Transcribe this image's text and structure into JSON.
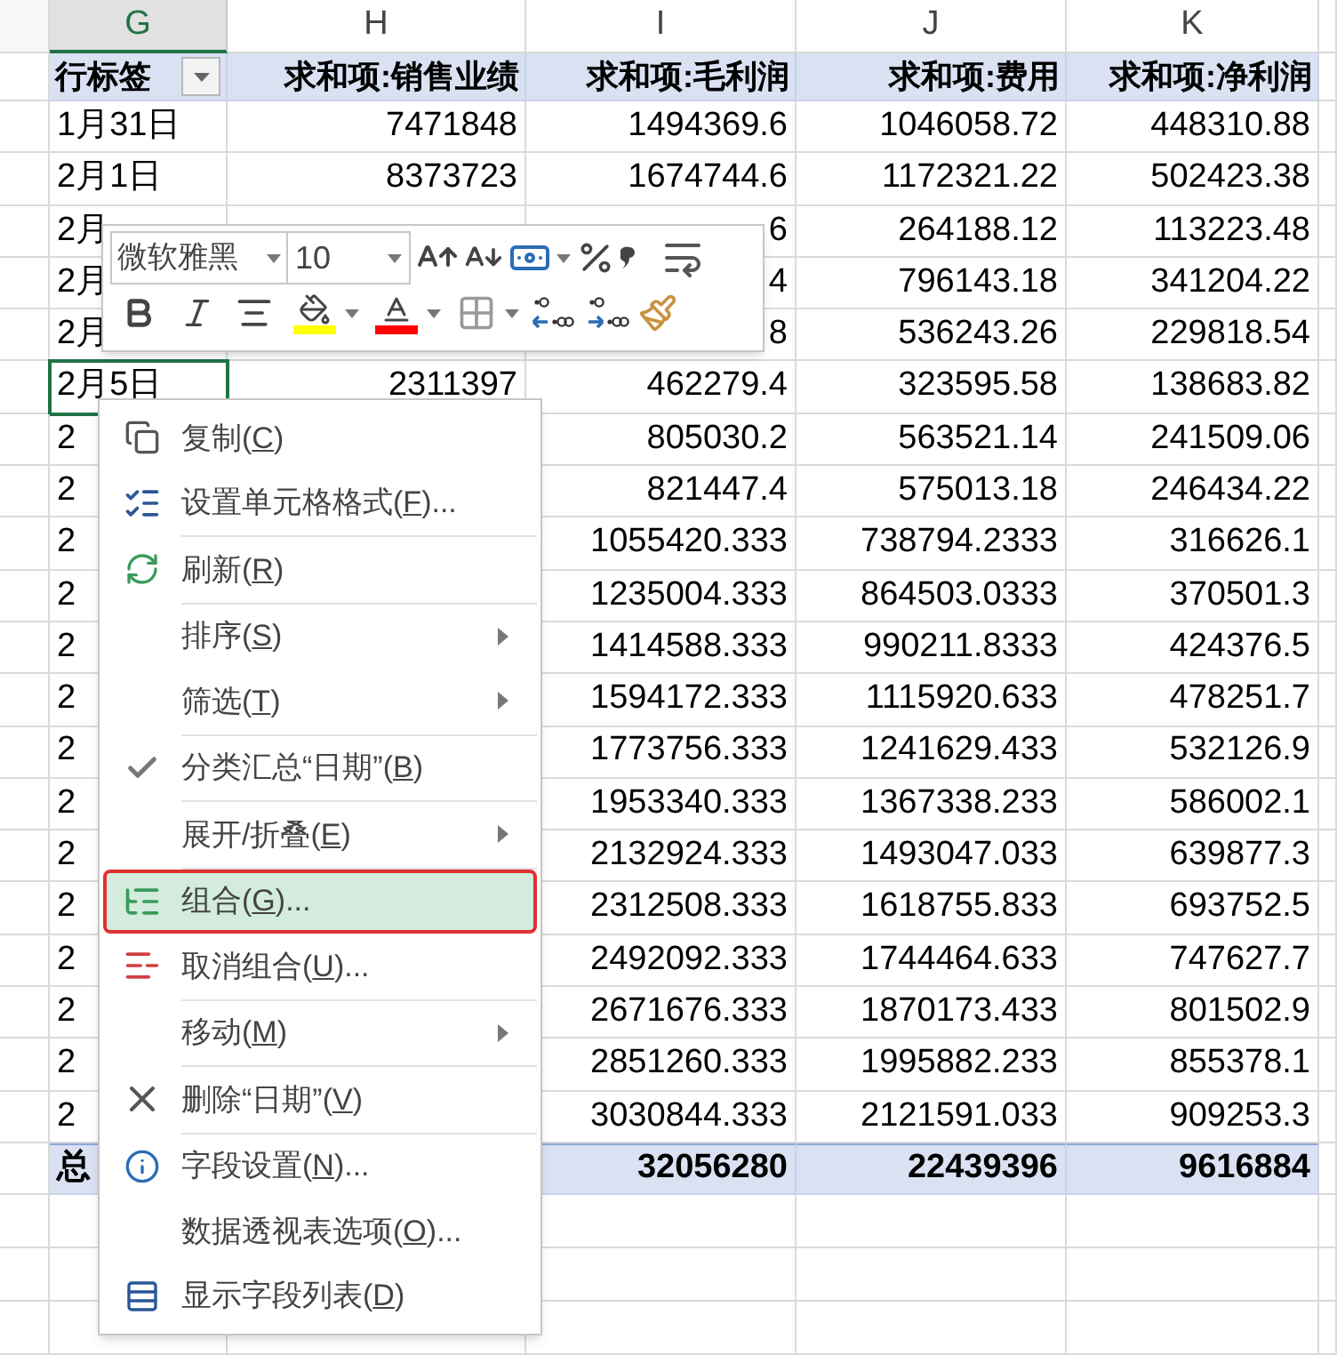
{
  "columns": [
    {
      "letter": "G",
      "selected": true
    },
    {
      "letter": "H",
      "selected": false
    },
    {
      "letter": "I",
      "selected": false
    },
    {
      "letter": "J",
      "selected": false
    },
    {
      "letter": "K",
      "selected": false
    }
  ],
  "pivot": {
    "headers": [
      {
        "text": "行标签",
        "filter": true
      },
      {
        "text": "求和项:销售业绩",
        "filter": false
      },
      {
        "text": "求和项:毛利润",
        "filter": false
      },
      {
        "text": "求和项:费用",
        "filter": false
      },
      {
        "text": "求和项:净利润",
        "filter": false
      }
    ],
    "rows": [
      {
        "label": "1月31日",
        "selected": false,
        "values": {
          "H": "7471848",
          "I": "1494369.6",
          "J": "1046058.72",
          "K": "448310.88"
        }
      },
      {
        "label": "2月1日",
        "selected": false,
        "values": {
          "H": "8373723",
          "I": "1674744.6",
          "J": "1172321.22",
          "K": "502423.38"
        }
      },
      {
        "label": "2月",
        "selected": false,
        "values": {
          "I": "6",
          "J": "264188.12",
          "K": "113223.48"
        }
      },
      {
        "label": "2月",
        "selected": false,
        "values": {
          "I": "4",
          "J": "796143.18",
          "K": "341204.22"
        }
      },
      {
        "label": "2月",
        "selected": false,
        "values": {
          "I": "8",
          "J": "536243.26",
          "K": "229818.54"
        }
      },
      {
        "label": "2月5日",
        "selected": true,
        "values": {
          "H": "2311397",
          "I": "462279.4",
          "J": "323595.58",
          "K": "138683.82"
        }
      },
      {
        "label": "2",
        "selected": false,
        "values": {
          "I": "805030.2",
          "J": "563521.14",
          "K": "241509.06"
        }
      },
      {
        "label": "2",
        "selected": false,
        "values": {
          "I": "821447.4",
          "J": "575013.18",
          "K": "246434.22"
        }
      },
      {
        "label": "2",
        "selected": false,
        "values": {
          "I": "1055420.333",
          "J": "738794.2333",
          "K": "316626.1"
        }
      },
      {
        "label": "2",
        "selected": false,
        "values": {
          "I": "1235004.333",
          "J": "864503.0333",
          "K": "370501.3"
        }
      },
      {
        "label": "2",
        "selected": false,
        "values": {
          "I": "1414588.333",
          "J": "990211.8333",
          "K": "424376.5"
        }
      },
      {
        "label": "2",
        "selected": false,
        "values": {
          "I": "1594172.333",
          "J": "1115920.633",
          "K": "478251.7"
        }
      },
      {
        "label": "2",
        "selected": false,
        "values": {
          "I": "1773756.333",
          "J": "1241629.433",
          "K": "532126.9"
        }
      },
      {
        "label": "2",
        "selected": false,
        "values": {
          "I": "1953340.333",
          "J": "1367338.233",
          "K": "586002.1"
        }
      },
      {
        "label": "2",
        "selected": false,
        "values": {
          "I": "2132924.333",
          "J": "1493047.033",
          "K": "639877.3"
        }
      },
      {
        "label": "2",
        "selected": false,
        "values": {
          "I": "2312508.333",
          "J": "1618755.833",
          "K": "693752.5"
        }
      },
      {
        "label": "2",
        "selected": false,
        "values": {
          "I": "2492092.333",
          "J": "1744464.633",
          "K": "747627.7"
        }
      },
      {
        "label": "2",
        "selected": false,
        "values": {
          "I": "2671676.333",
          "J": "1870173.433",
          "K": "801502.9"
        }
      },
      {
        "label": "2",
        "selected": false,
        "values": {
          "I": "2851260.333",
          "J": "1995882.233",
          "K": "855378.1"
        }
      },
      {
        "label": "2",
        "selected": false,
        "values": {
          "I": "3030844.333",
          "J": "2121591.033",
          "K": "909253.3"
        }
      }
    ],
    "total": {
      "label": "总",
      "values": {
        "I": "32056280",
        "J": "22439396",
        "K": "9616884"
      }
    }
  },
  "mini_toolbar": {
    "font": "微软雅黑",
    "size": "10"
  },
  "context_menu": [
    {
      "label": "复制(",
      "key": "C",
      "after": ")",
      "submenu": false,
      "checked": false,
      "selected": false,
      "separator_after": false
    },
    {
      "label": "设置单元格格式(",
      "key": "F",
      "after": ")...",
      "submenu": false,
      "checked": false,
      "selected": false,
      "separator_after": true
    },
    {
      "label": "刷新(",
      "key": "R",
      "after": ")",
      "submenu": false,
      "checked": false,
      "selected": false,
      "separator_after": true
    },
    {
      "label": "排序(",
      "key": "S",
      "after": ")",
      "submenu": true,
      "checked": false,
      "selected": false,
      "separator_after": false
    },
    {
      "label": "筛选(",
      "key": "T",
      "after": ")",
      "submenu": true,
      "checked": false,
      "selected": false,
      "separator_after": true
    },
    {
      "label": "分类汇总“日期”(",
      "key": "B",
      "after": ")",
      "submenu": false,
      "checked": true,
      "selected": false,
      "separator_after": true
    },
    {
      "label": "展开/折叠(",
      "key": "E",
      "after": ")",
      "submenu": true,
      "checked": false,
      "selected": false,
      "separator_after": true
    },
    {
      "label": "组合(",
      "key": "G",
      "after": ")...",
      "submenu": false,
      "checked": false,
      "selected": true,
      "separator_after": false
    },
    {
      "label": "取消组合(",
      "key": "U",
      "after": ")...",
      "submenu": false,
      "checked": false,
      "selected": false,
      "separator_after": true
    },
    {
      "label": "移动(",
      "key": "M",
      "after": ")",
      "submenu": true,
      "checked": false,
      "selected": false,
      "separator_after": true
    },
    {
      "label": "删除“日期”(",
      "key": "V",
      "after": ")",
      "submenu": false,
      "checked": false,
      "selected": false,
      "separator_after": true
    },
    {
      "label": "字段设置(",
      "key": "N",
      "after": ")...",
      "submenu": false,
      "checked": false,
      "selected": false,
      "separator_after": false
    },
    {
      "label": "数据透视表选项(",
      "key": "O",
      "after": ")...",
      "submenu": false,
      "checked": false,
      "selected": false,
      "separator_after": false
    },
    {
      "label": "显示字段列表(",
      "key": "D",
      "after": ")",
      "submenu": false,
      "checked": false,
      "selected": false,
      "separator_after": false
    }
  ]
}
